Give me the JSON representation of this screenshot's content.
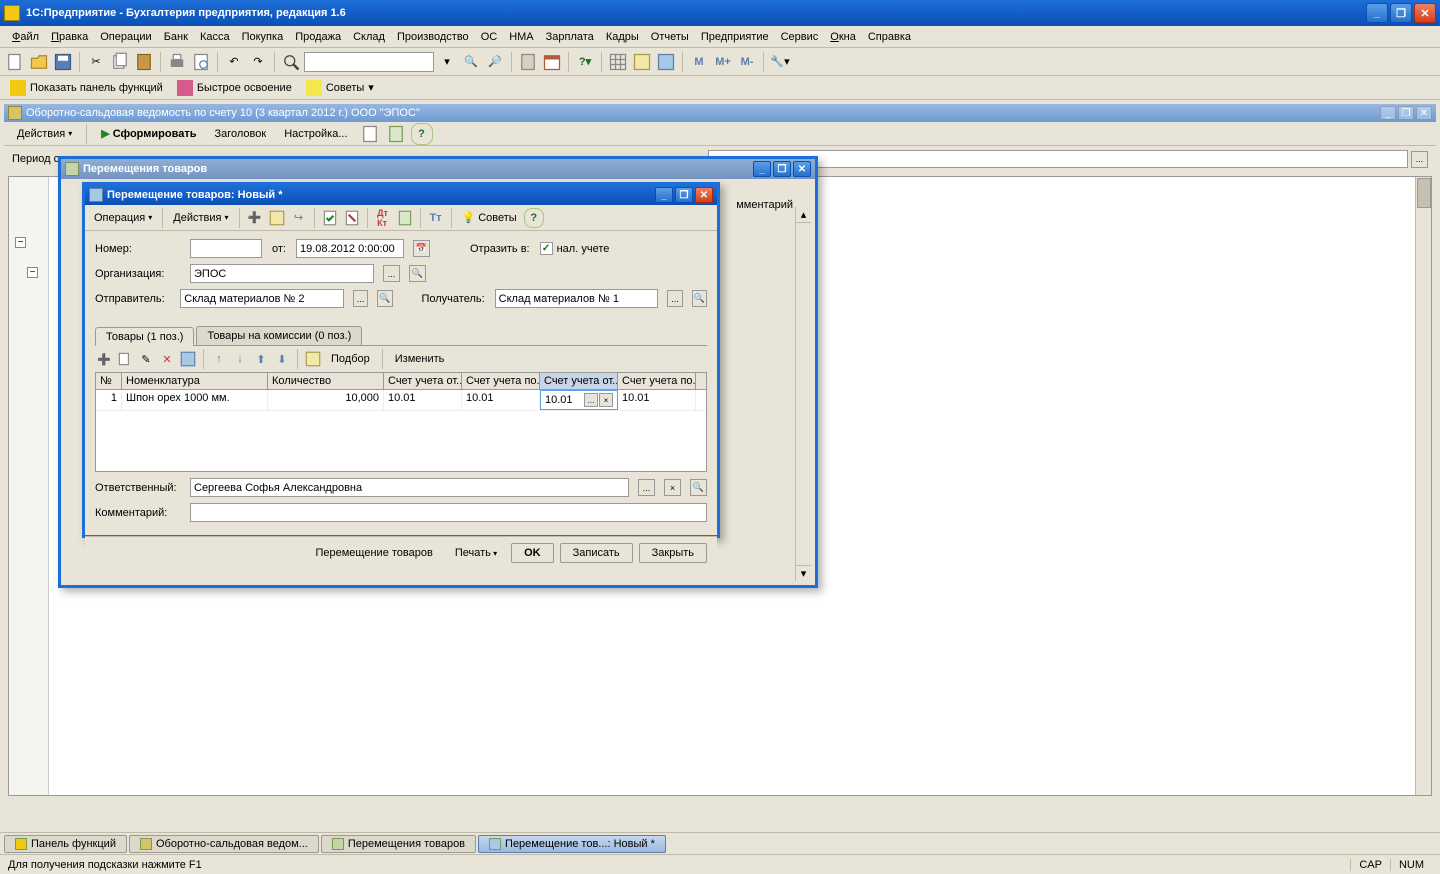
{
  "app": {
    "title": "1С:Предприятие  - Бухгалтерия предприятия, редакция 1.6"
  },
  "menu": {
    "file": "Файл",
    "edit": "Правка",
    "ops": "Операции",
    "bank": "Банк",
    "kassa": "Касса",
    "buy": "Покупка",
    "sell": "Продажа",
    "sklad": "Склад",
    "proizv": "Производство",
    "os": "ОС",
    "nma": "НМА",
    "salary": "Зарплата",
    "kadry": "Кадры",
    "reports": "Отчеты",
    "company": "Предприятие",
    "service": "Сервис",
    "windows": "Окна",
    "help": "Справка"
  },
  "toolbar2": {
    "show_panel": "Показать панель функций",
    "quick": "Быстрое освоение",
    "tips": "Советы"
  },
  "mdi": {
    "sub_title": "Оборотно-сальдовая ведомость по счету 10 (3 квартал 2012 г.) ООО \"ЭПОС\"",
    "actions": "Действия",
    "form": "Сформировать",
    "header": "Заголовок",
    "settings": "Настройка...",
    "period_label": "Период с"
  },
  "list_modal": {
    "title": "Перемещения товаров",
    "col_comment": "мментарий"
  },
  "doc": {
    "title": "Перемещение товаров: Новый *",
    "operation": "Операция",
    "actions": "Действия",
    "tips": "Советы",
    "number_label": "Номер:",
    "from_label": "от:",
    "date": "19.08.2012  0:00:00",
    "reflect_label": "Отразить в:",
    "nal": "нал. учете",
    "org_label": "Организация:",
    "org_value": "ЭПОС",
    "sender_label": "Отправитель:",
    "sender_value": "Склад материалов № 2",
    "receiver_label": "Получатель:",
    "receiver_value": "Склад материалов № 1",
    "tab_goods": "Товары (1 поз.)",
    "tab_komis": "Товары на комиссии (0 поз.)",
    "selection": "Подбор",
    "change": "Изменить",
    "grid_headers": {
      "num": "№",
      "nomen": "Номенклатура",
      "qty": "Количество",
      "acc_from": "Счет учета от...",
      "acc_to": "Счет учета по...",
      "acc_from2": "Счет учета от...",
      "acc_to2": "Счет учета по..."
    },
    "grid_row": {
      "num": "1",
      "nomen": "Шпон орех 1000 мм.",
      "qty": "10,000",
      "a1": "10.01",
      "a2": "10.01",
      "a3": "10.01",
      "a4": "10.01"
    },
    "resp_label": "Ответственный:",
    "resp_value": "Сергеева Софья Александровна",
    "comment_label": "Комментарий:",
    "footer_name": "Перемещение товаров",
    "print": "Печать",
    "ok": "OK",
    "write": "Записать",
    "close": "Закрыть"
  },
  "taskbar": {
    "panel": "Панель функций",
    "osv": "Оборотно-сальдовая ведом...",
    "list": "Перемещения товаров",
    "doc": "Перемещение тов...: Новый *"
  },
  "status": {
    "hint": "Для получения подсказки нажмите F1",
    "cap": "CAP",
    "num": "NUM"
  }
}
